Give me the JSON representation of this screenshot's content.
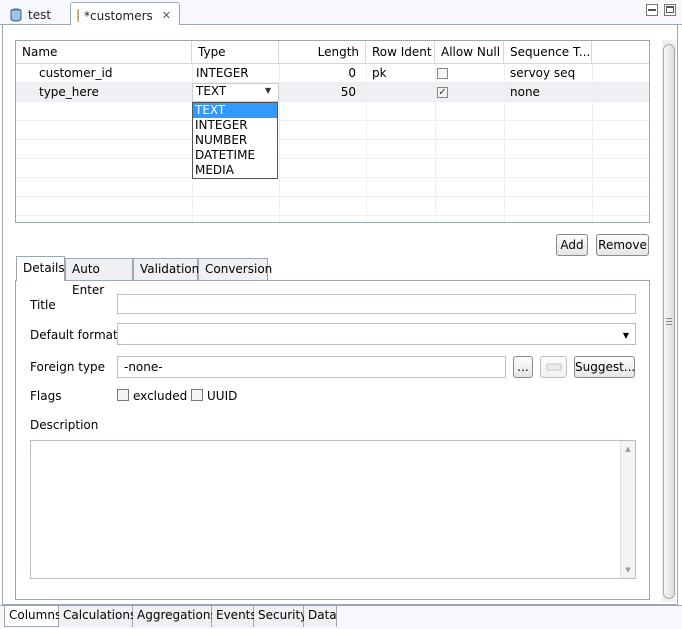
{
  "editor_tabs": [
    {
      "label": "test",
      "icon": "database-icon"
    },
    {
      "label": "*customers",
      "icon": "table-icon"
    }
  ],
  "table": {
    "headers": [
      "Name",
      "Type",
      "Length",
      "Row Ident",
      "Allow Null",
      "Sequence T..."
    ],
    "rows": [
      {
        "name": "customer_id",
        "type": "INTEGER",
        "length": "0",
        "row_ident": "pk",
        "allow_null": false,
        "sequence": "servoy seq"
      },
      {
        "name": "type_here",
        "type": "TEXT",
        "length": "50",
        "row_ident": "",
        "allow_null": true,
        "sequence": "none"
      }
    ]
  },
  "type_dropdown": {
    "selected": "TEXT",
    "options": [
      "TEXT",
      "INTEGER",
      "NUMBER",
      "DATETIME",
      "MEDIA"
    ]
  },
  "buttons": {
    "add": "Add",
    "remove": "Remove"
  },
  "detail_tabs": [
    "Details",
    "Auto Enter",
    "Validation",
    "Conversion"
  ],
  "details": {
    "title_label": "Title",
    "title_value": "",
    "default_format_label": "Default format",
    "default_format_value": "",
    "foreign_type_label": "Foreign type",
    "foreign_type_value": "-none-",
    "browse_label": "...",
    "suggest_label": "Suggest...",
    "flags_label": "Flags",
    "flag_excluded": "excluded",
    "flag_uuid": "UUID",
    "description_label": "Description",
    "description_value": ""
  },
  "bottom_tabs": [
    "Columns",
    "Calculations",
    "Aggregations",
    "Events",
    "Security",
    "Data"
  ],
  "colors": {
    "selection": "#3399ff",
    "border": "#9da7b4"
  }
}
